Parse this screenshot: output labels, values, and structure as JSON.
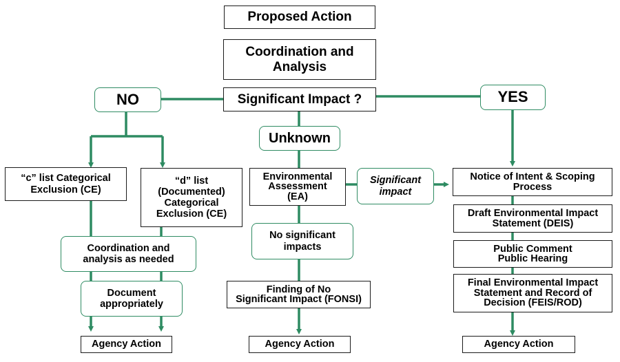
{
  "colors": {
    "connector": "#2e8b62",
    "rect_border": "#1a1a1a",
    "round_border": "#2e8b62"
  },
  "nodes": {
    "proposed_action": "Proposed Action",
    "coordination_analysis": "Coordination and\nAnalysis",
    "significant_impact_q": "Significant Impact ?",
    "no": "NO",
    "yes": "YES",
    "unknown": "Unknown",
    "c_list": "“c” list  Categorical\nExclusion (CE)",
    "d_list": "“d” list\n(Documented)\nCategorical\nExclusion (CE)",
    "coord_as_needed": "Coordination and\nanalysis as needed",
    "document_appropriately": "Document\nappropriately",
    "agency_action_left": "Agency Action",
    "ea": "Environmental\nAssessment\n(EA)",
    "significant_impact_branch": "Significant\nimpact",
    "no_significant_impacts": "No significant\nimpacts",
    "fonsi": "Finding of No\nSignificant Impact (FONSI)",
    "agency_action_center": "Agency Action",
    "noi": "Notice of Intent & Scoping\nProcess",
    "deis": "Draft Environmental Impact\nStatement (DEIS)",
    "public_comment": "Public Comment\nPublic Hearing",
    "feis_rod": "Final Environmental Impact\nStatement  and  Record of\nDecision (FEIS/ROD)",
    "agency_action_right": "Agency Action"
  }
}
